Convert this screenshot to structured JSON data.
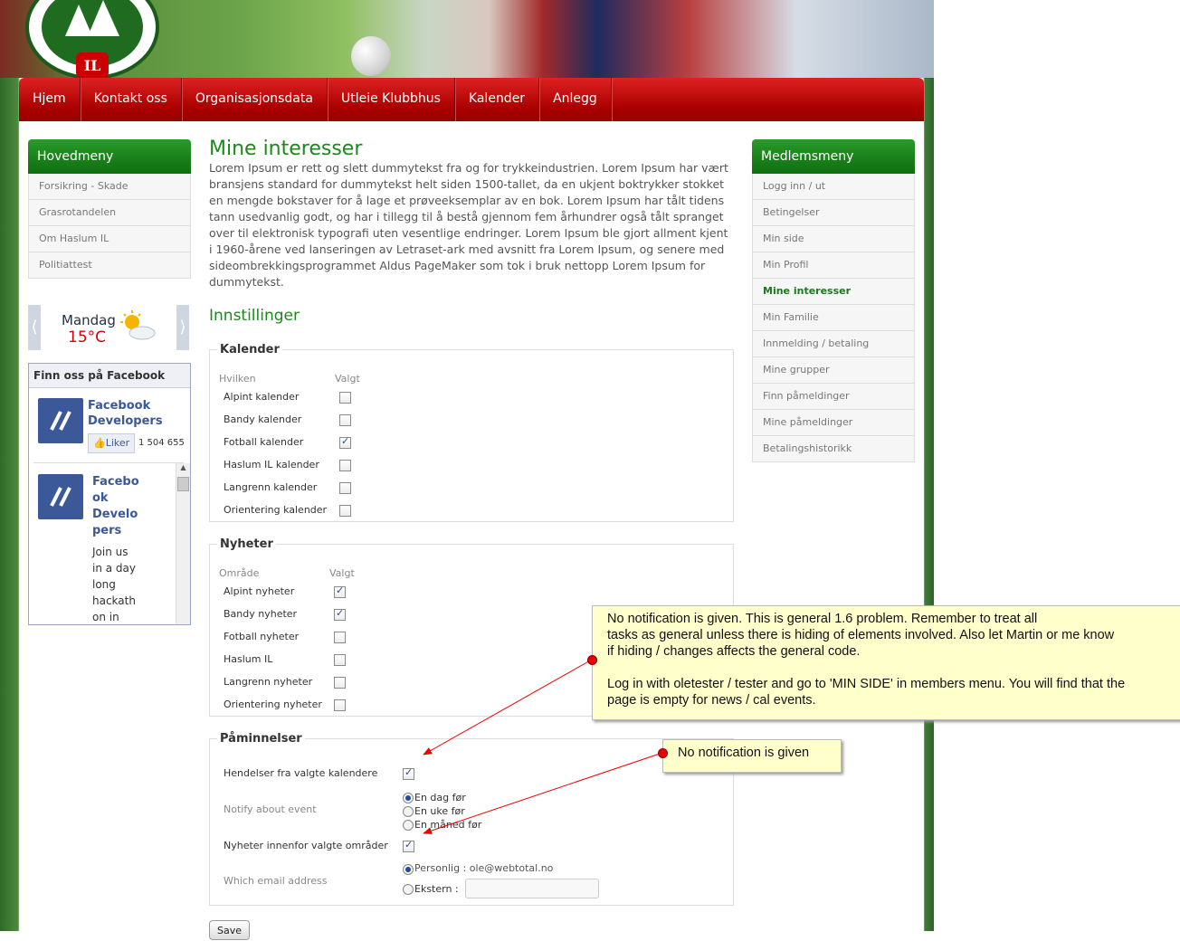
{
  "nav": [
    "Hjem",
    "Kontakt oss",
    "Organisasjonsdata",
    "Utleie Klubbhus",
    "Kalender",
    "Anlegg"
  ],
  "logo_text": "IL",
  "main_menu": {
    "title": "Hovedmeny",
    "items": [
      "Forsikring - Skade",
      "Grasrotandelen",
      "Om Haslum IL",
      "Politiattest"
    ]
  },
  "weather": {
    "day": "Mandag",
    "temp": "15°C",
    "prev": "⟨",
    "next": "⟩"
  },
  "facebook": {
    "title": "Finn oss på Facebook",
    "page1": "Facebook Developers",
    "like": "Liker",
    "count": "1 504 655",
    "page2": "Facebo ok Develo pers",
    "post": "Join us in a day long hackath on in"
  },
  "member_menu": {
    "title": "Medlemsmeny",
    "items": [
      "Logg inn / ut",
      "Betingelser",
      "Min side",
      "Min Profil",
      "Mine interesser",
      "Min Familie",
      "Innmelding / betaling",
      "Mine grupper",
      "Finn påmeldinger",
      "Mine påmeldinger",
      "Betalingshistorikk"
    ],
    "active": 4
  },
  "page_title": "Mine interesser",
  "lorem": "Lorem Ipsum er rett og slett dummytekst fra og for trykkeindustrien. Lorem Ipsum har vært bransjens standard for dummytekst helt siden 1500-tallet, da en ukjent boktrykker stokket en mengde bokstaver for å lage et prøveeksemplar av en bok. Lorem Ipsum har tålt tidens tann usedvanlig godt, og har i tillegg til å bestå gjennom fem århundrer også tålt spranget over til elektronisk typografi uten vesentlige endringer. Lorem Ipsum ble gjort allment kjent i 1960-årene ved lanseringen av Letraset-ark med avsnitt fra Lorem Ipsum, og senere med sideombrekkingsprogrammet Aldus PageMaker som tok i bruk nettopp Lorem Ipsum for dummytekst.",
  "settings_title": "Innstillinger",
  "kalender": {
    "legend": "Kalender",
    "col1": "Hvilken",
    "col2": "Valgt",
    "rows": [
      {
        "label": "Alpint kalender",
        "checked": false
      },
      {
        "label": "Bandy kalender",
        "checked": false
      },
      {
        "label": "Fotball kalender",
        "checked": true
      },
      {
        "label": "Haslum IL kalender",
        "checked": false
      },
      {
        "label": "Langrenn kalender",
        "checked": false
      },
      {
        "label": "Orientering kalender",
        "checked": false
      }
    ]
  },
  "nyheter": {
    "legend": "Nyheter",
    "col1": "Område",
    "col2": "Valgt",
    "rows": [
      {
        "label": "Alpint nyheter",
        "checked": true
      },
      {
        "label": "Bandy nyheter",
        "checked": true
      },
      {
        "label": "Fotball nyheter",
        "checked": false
      },
      {
        "label": "Haslum IL",
        "checked": false
      },
      {
        "label": "Langrenn nyheter",
        "checked": false
      },
      {
        "label": "Orientering nyheter",
        "checked": false
      }
    ]
  },
  "paminnelser": {
    "legend": "Påminnelser",
    "events_label": "Hendelser fra valgte kalendere",
    "events_checked": true,
    "notify_label": "Notify about event",
    "notify_options": [
      "En dag før",
      "En uke før",
      "En måned før"
    ],
    "notify_selected": 0,
    "news_label": "Nyheter innenfor valgte områder",
    "news_checked": true,
    "email_label": "Which email address",
    "email_personal": "Personlig : ole@webtotal.no",
    "email_external": "Ekstern :",
    "email_selected": 0
  },
  "save": "Save",
  "note1": {
    "lines": [
      "No notification is given. This is general 1.6 problem. Remember to treat all",
      "tasks as general unless there is hiding of elements involved. Also let Martin or me know",
      "if hiding / changes affects the general code.",
      "",
      "Log in with oletester / tester and go to 'MIN SIDE' in members menu. You will find that the",
      "page is empty for news / cal events."
    ]
  },
  "note2": "No notification is given",
  "colors": {
    "nav_red": "#c00000",
    "menu_green": "#1a8a1a",
    "note_yellow": "#ffffcc",
    "arrow_red": "#e00000"
  }
}
